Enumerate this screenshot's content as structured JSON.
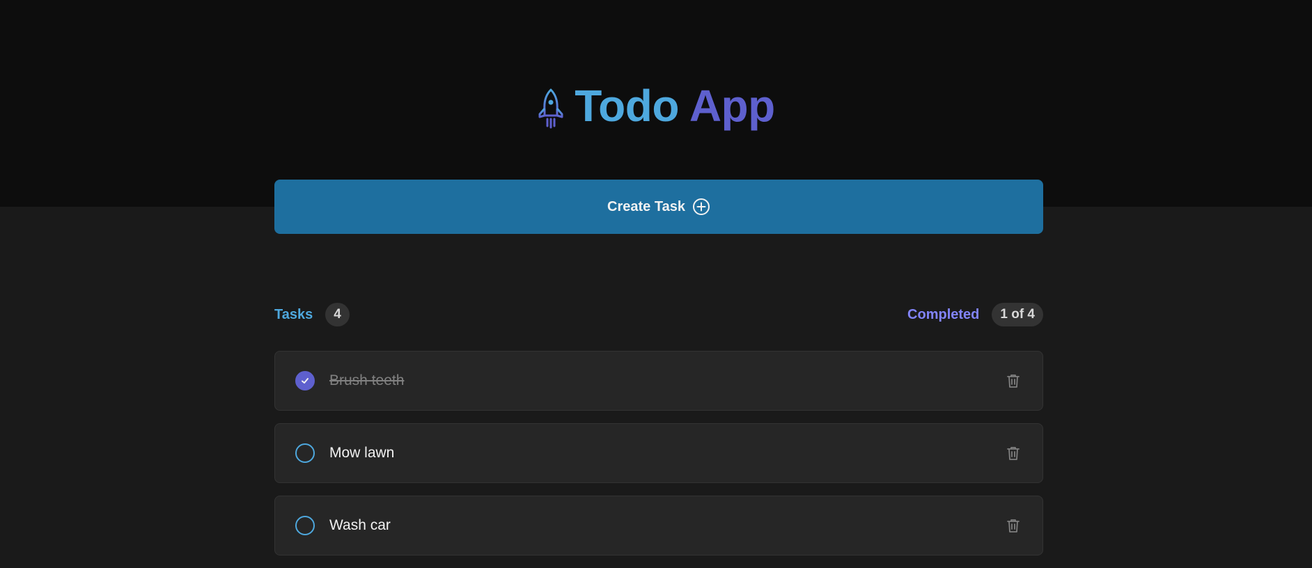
{
  "header": {
    "title_word1": "Todo",
    "title_word2": "App",
    "icon": "rocket-icon"
  },
  "create_button": {
    "label": "Create Task",
    "icon": "plus-circle-icon"
  },
  "summary": {
    "tasks_label": "Tasks",
    "tasks_count": "4",
    "completed_label": "Completed",
    "completed_count": "1 of 4"
  },
  "tasks": [
    {
      "text": "Brush teeth",
      "completed": true
    },
    {
      "text": "Mow lawn",
      "completed": false
    },
    {
      "text": "Wash car",
      "completed": false
    }
  ],
  "colors": {
    "header_bg": "#0d0d0d",
    "page_bg": "#1a1a1a",
    "blue": "#4ea8de",
    "purple": "#5e60ce",
    "button_bg": "#1e6f9f",
    "purple_light": "#8284fa"
  }
}
